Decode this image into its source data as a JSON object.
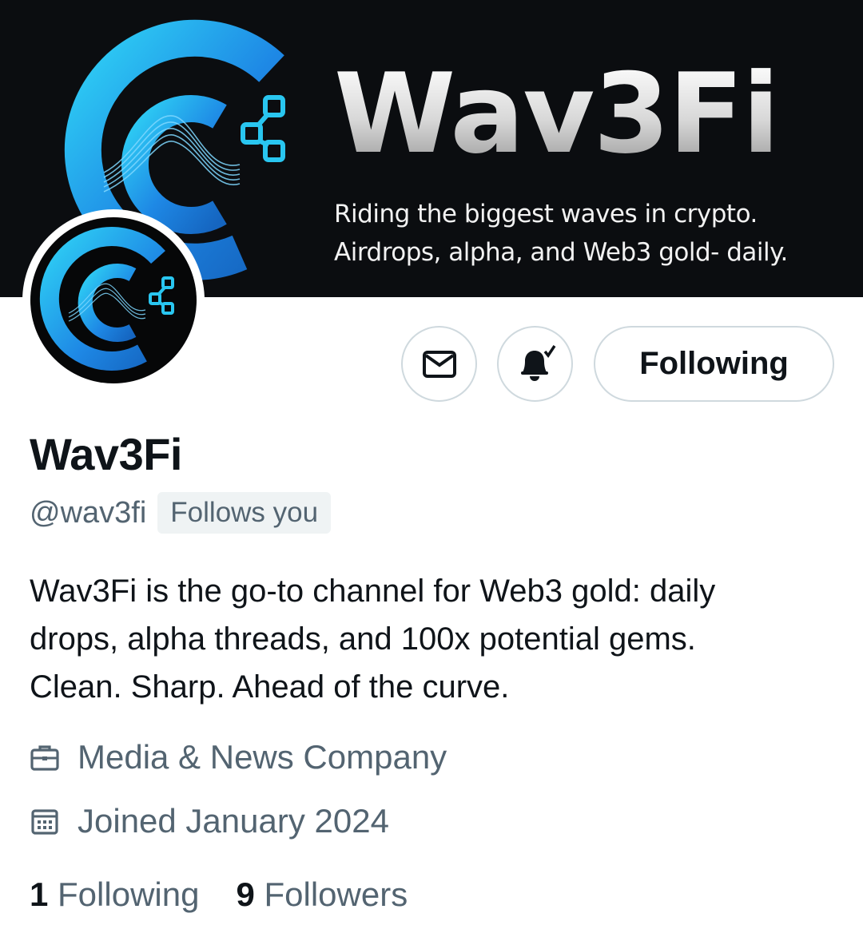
{
  "banner": {
    "title": "Wav3Fi",
    "tagline_line1": "Riding the biggest waves in crypto.",
    "tagline_line2": "Airdrops, alpha, and Web3 gold- daily.",
    "logo_icon": "wav3fi-logo-icon"
  },
  "colors": {
    "banner_bg": "#0b0d10",
    "brand_blue": "#1e88e5",
    "brand_cyan": "#29c6f0",
    "text_primary": "#0f1419",
    "text_secondary": "#536471",
    "button_border": "#cfd9de"
  },
  "actions": {
    "message_icon": "envelope-icon",
    "notifications_icon": "bell-check-icon",
    "follow_label": "Following"
  },
  "profile": {
    "display_name": "Wav3Fi",
    "handle": "@wav3fi",
    "follows_you": "Follows you",
    "bio_lines": [
      "Wav3Fi is the go-to channel for Web3 gold: daily",
      "drops, alpha threads, and 100x potential gems.",
      "Clean. Sharp. Ahead of the curve."
    ],
    "category": "Media & News Company",
    "category_icon": "briefcase-icon",
    "joined": "Joined January 2024",
    "joined_icon": "calendar-icon"
  },
  "stats": {
    "following_count": "1",
    "following_label": "Following",
    "followers_count": "9",
    "followers_label": "Followers"
  }
}
